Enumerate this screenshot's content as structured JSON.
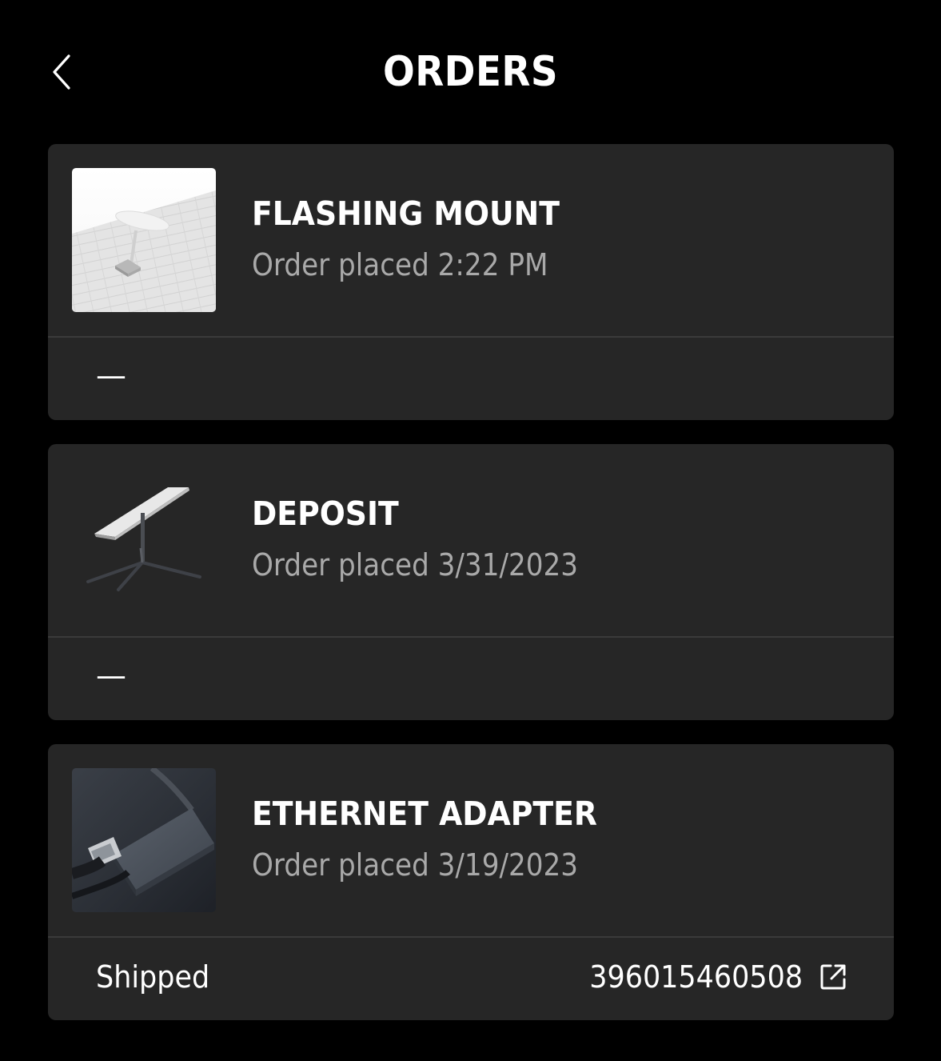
{
  "header": {
    "title": "ORDERS",
    "back_icon": "chevron-left-icon"
  },
  "orders": [
    {
      "title": "FLASHING MOUNT",
      "date": "Order placed 2:22 PM",
      "status": "—",
      "thumbnail": "flashing-mount-image"
    },
    {
      "title": "DEPOSIT",
      "date": "Order placed 3/31/2023",
      "status": "—",
      "thumbnail": "starlink-dish-image"
    },
    {
      "title": "ETHERNET ADAPTER",
      "date": "Order placed 3/19/2023",
      "status": "Shipped",
      "tracking_number": "396015460508",
      "tracking_icon": "external-link-icon",
      "thumbnail": "ethernet-adapter-image"
    }
  ],
  "colors": {
    "background": "#000000",
    "card": "#262626",
    "divider": "#3a3a3a",
    "secondary_text": "#a9a9a9",
    "primary_text": "#ffffff"
  }
}
